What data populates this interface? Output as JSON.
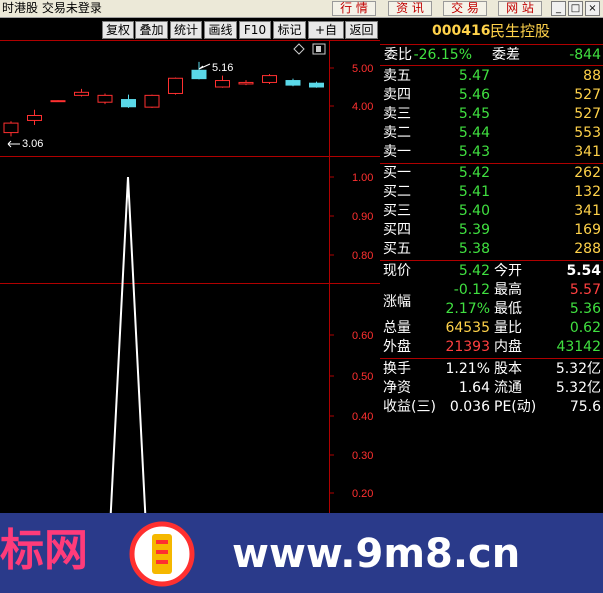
{
  "window": {
    "title": "时港股 交易未登录",
    "nav": [
      "行 情",
      "资 讯",
      "交 易",
      "网 站"
    ],
    "controls": [
      "_",
      "□",
      "×"
    ]
  },
  "toolbar": {
    "buttons": [
      "复权",
      "叠加",
      "统计",
      "画线",
      "F10",
      "标记",
      "+自选",
      "返回"
    ]
  },
  "kline": {
    "high_label": "5.16",
    "low_label": "3.06",
    "axis_ticks": [
      "5.00",
      "4.00"
    ],
    "candles": [
      {
        "o": 3.3,
        "c": 3.55,
        "h": 3.6,
        "l": 3.2,
        "up": true
      },
      {
        "o": 3.62,
        "c": 3.75,
        "h": 3.9,
        "l": 3.5,
        "up": true
      },
      {
        "o": 4.12,
        "c": 4.14,
        "h": 4.15,
        "l": 4.12,
        "up": true
      },
      {
        "o": 4.28,
        "c": 4.36,
        "h": 4.45,
        "l": 4.25,
        "up": true
      },
      {
        "o": 4.1,
        "c": 4.28,
        "h": 4.33,
        "l": 4.05,
        "up": true
      },
      {
        "o": 4.17,
        "c": 3.98,
        "h": 4.3,
        "l": 3.95,
        "up": false
      },
      {
        "o": 3.97,
        "c": 4.28,
        "h": 4.3,
        "l": 3.95,
        "up": true
      },
      {
        "o": 4.33,
        "c": 4.73,
        "h": 4.75,
        "l": 4.3,
        "up": true
      },
      {
        "o": 4.94,
        "c": 4.72,
        "h": 5.16,
        "l": 4.7,
        "up": false
      },
      {
        "o": 4.5,
        "c": 4.67,
        "h": 4.8,
        "l": 4.48,
        "up": true
      },
      {
        "o": 4.58,
        "c": 4.62,
        "h": 4.68,
        "l": 4.55,
        "up": true
      },
      {
        "o": 4.62,
        "c": 4.8,
        "h": 4.84,
        "l": 4.58,
        "up": true
      },
      {
        "o": 4.67,
        "c": 4.55,
        "h": 4.72,
        "l": 4.52,
        "up": false
      },
      {
        "o": 4.6,
        "c": 4.5,
        "h": 4.64,
        "l": 4.48,
        "up": false
      }
    ]
  },
  "indicator1": {
    "axis_ticks": [
      "1.00",
      "0.90",
      "0.80"
    ],
    "line": [
      [
        108,
        0.0
      ],
      [
        128,
        1.0
      ],
      [
        148,
        0.0
      ]
    ]
  },
  "indicator2": {
    "axis_ticks": [
      "0.60",
      "0.50",
      "0.40",
      "0.30",
      "0.20"
    ]
  },
  "quote": {
    "code": "000416",
    "name": "民生控股",
    "weibi_label": "委比",
    "weibi": "-26.15%",
    "weicha_label": "委差",
    "weicha": "-844",
    "asks": [
      {
        "label": "卖五",
        "price": "5.47",
        "vol": "88"
      },
      {
        "label": "卖四",
        "price": "5.46",
        "vol": "527"
      },
      {
        "label": "卖三",
        "price": "5.45",
        "vol": "527"
      },
      {
        "label": "卖二",
        "price": "5.44",
        "vol": "553"
      },
      {
        "label": "卖一",
        "price": "5.43",
        "vol": "341"
      }
    ],
    "bids": [
      {
        "label": "买一",
        "price": "5.42",
        "vol": "262"
      },
      {
        "label": "买二",
        "price": "5.41",
        "vol": "132"
      },
      {
        "label": "买三",
        "price": "5.40",
        "vol": "341"
      },
      {
        "label": "买四",
        "price": "5.39",
        "vol": "169"
      },
      {
        "label": "买五",
        "price": "5.38",
        "vol": "288"
      }
    ],
    "stats": {
      "xianjia_label": "现价",
      "xianjia": "5.42",
      "jinkai_label": "今开",
      "jinkai": "5.54",
      "change": "-0.12",
      "zuigao_label": "最高",
      "zuigao": "5.57",
      "zhangfu_label": "涨幅",
      "zhangfu": "2.17%",
      "zuidi_label": "最低",
      "zuidi": "5.36",
      "zongliang_label": "总量",
      "zongliang": "64535",
      "liangbi_label": "量比",
      "liangbi": "0.62",
      "waipan_label": "外盘",
      "waipan": "21393",
      "neipan_label": "内盘",
      "neipan": "43142",
      "huanshou_label": "换手",
      "huanshou": "1.21%",
      "guben_label": "股本",
      "guben": "5.32亿",
      "jingzi_label": "净资",
      "jingzi": "1.64",
      "liutong_label": "流通",
      "liutong": "5.32亿",
      "shouyi_label": "收益(三)",
      "shouyi": "0.036",
      "pe_label": "PE(动)",
      "pe": "75.6"
    }
  },
  "banner": {
    "left_text": "标网",
    "url_text": "www.9m8.cn"
  }
}
